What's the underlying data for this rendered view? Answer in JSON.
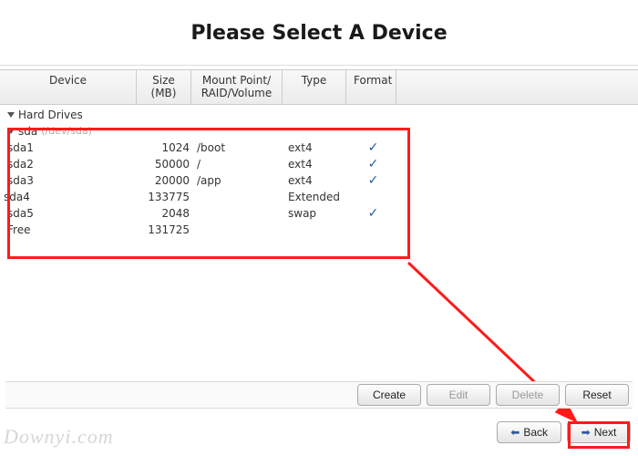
{
  "title": "Please Select A Device",
  "columns": {
    "device": "Device",
    "size": "Size\n(MB)",
    "mount": "Mount Point/\nRAID/Volume",
    "type": "Type",
    "format": "Format"
  },
  "tree": {
    "hardDrives": "Hard Drives",
    "sda": {
      "label": "sda",
      "path": "(/dev/sda)"
    },
    "rows": [
      {
        "device": "sda1",
        "size": "1024",
        "mount": "/boot",
        "type": "ext4",
        "format": true
      },
      {
        "device": "sda2",
        "size": "50000",
        "mount": "/",
        "type": "ext4",
        "format": true
      },
      {
        "device": "sda3",
        "size": "20000",
        "mount": "/app",
        "type": "ext4",
        "format": true
      },
      {
        "device": "sda4",
        "size": "133775",
        "mount": "",
        "type": "Extended",
        "format": false,
        "expandable": true
      },
      {
        "device": "sda5",
        "size": "2048",
        "mount": "",
        "type": "swap",
        "format": true,
        "child": true
      },
      {
        "device": "Free",
        "size": "131725",
        "mount": "",
        "type": "",
        "format": false,
        "child": true
      }
    ]
  },
  "buttons": {
    "create": "Create",
    "edit": "Edit",
    "delete": "Delete",
    "reset": "Reset",
    "back": "Back",
    "next": "Next"
  },
  "watermark": "Downyi.com"
}
